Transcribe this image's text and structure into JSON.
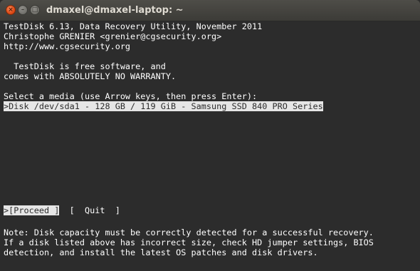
{
  "window": {
    "title": "dmaxel@dmaxel-laptop: ~",
    "buttons": {
      "close": "×",
      "minimize": "–",
      "maximize": "□"
    }
  },
  "terminal": {
    "header": [
      "TestDisk 6.13, Data Recovery Utility, November 2011",
      "Christophe GRENIER <grenier@cgsecurity.org>",
      "http://www.cgsecurity.org"
    ],
    "license": [
      "  TestDisk is free software, and",
      "comes with ABSOLUTELY NO WARRANTY."
    ],
    "prompt": "Select a media (use Arrow keys, then press Enter):",
    "disks": [
      ">Disk /dev/sda1 - 128 GB / 119 GiB - Samsung SSD 840 PRO Series"
    ],
    "actions": {
      "proceed": ">[Proceed ]",
      "separator": "  ",
      "quit": "[  Quit  ]"
    },
    "note": [
      "Note: Disk capacity must be correctly detected for a successful recovery.",
      "If a disk listed above has incorrect size, check HD jumper settings, BIOS",
      "detection, and install the latest OS patches and disk drivers."
    ]
  }
}
